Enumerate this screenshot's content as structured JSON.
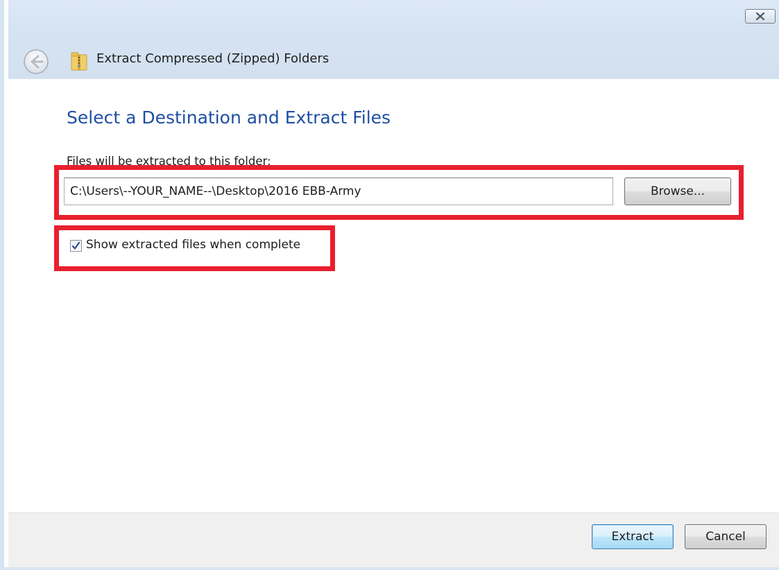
{
  "window": {
    "title": "Extract Compressed (Zipped) Folders"
  },
  "page": {
    "heading": "Select a Destination and Extract Files",
    "path_label": "Files will be extracted to this folder:",
    "path_value": "C:\\Users\\--YOUR_NAME--\\Desktop\\2016 EBB-Army",
    "browse_label": "Browse...",
    "show_files_label": "Show extracted files when complete",
    "show_files_checked": true
  },
  "footer": {
    "extract_label": "Extract",
    "cancel_label": "Cancel"
  },
  "icons": {
    "back": "back-arrow-icon",
    "folder": "zip-folder-icon",
    "close": "close-icon",
    "check": "checkmark-icon"
  },
  "colors": {
    "heading": "#1f4fa3",
    "highlight": "#e8202e",
    "titlebar": "#d5e3f2"
  }
}
